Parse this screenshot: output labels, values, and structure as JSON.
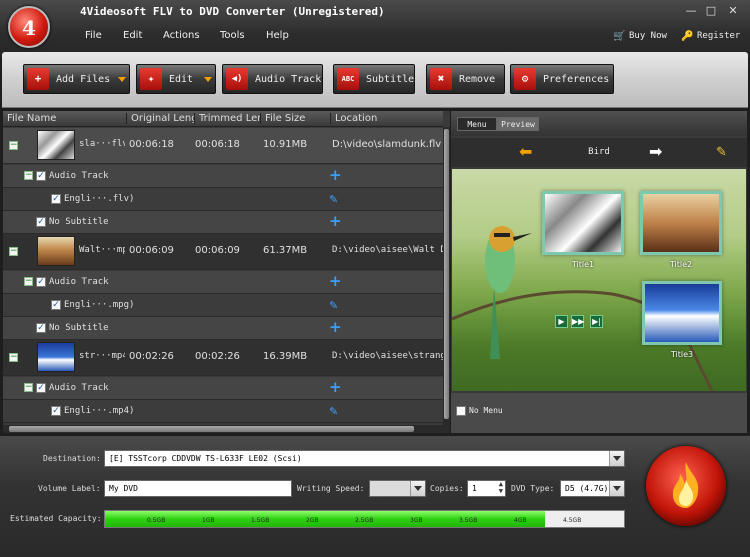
{
  "window": {
    "title": "4Videosoft FLV to DVD Converter (Unregistered)"
  },
  "menu": [
    "File",
    "Edit",
    "Actions",
    "Tools",
    "Help"
  ],
  "header_links": {
    "buy_now": "Buy Now",
    "register": "Register"
  },
  "toolbar": {
    "add_files": "Add Files",
    "add_files_icon": "+",
    "edit": "Edit",
    "edit_icon": "✦",
    "audio_track": "Audio Track",
    "audio_icon": "◀)",
    "subtitle": "Subtitle",
    "subtitle_icon": "ABC",
    "remove": "Remove",
    "remove_icon": "✖",
    "preferences": "Preferences",
    "preferences_icon": "⚙"
  },
  "file_list": {
    "columns": [
      "File Name",
      "Original Leng",
      "Trimmed Len",
      "File Size",
      "Location"
    ],
    "files": [
      {
        "name": "sla···flv",
        "original": "00:06:18",
        "trimmed": "00:06:18",
        "size": "10.91MB",
        "location": "D:\\video\\slamdunk.flv",
        "audio_label": "Audio Track",
        "audio_track": "Engli···.flv)",
        "subtitle": "No Subtitle"
      },
      {
        "name": "Walt···mpg",
        "original": "00:06:09",
        "trimmed": "00:06:09",
        "size": "61.37MB",
        "location": "D:\\video\\aisee\\Walt Dis",
        "audio_label": "Audio Track",
        "audio_track": "Engli···.mpg)",
        "subtitle": "No Subtitle"
      },
      {
        "name": "str···mp4",
        "original": "00:02:26",
        "trimmed": "00:02:26",
        "size": "16.39MB",
        "location": "D:\\video\\aisee\\strange",
        "audio_label": "Audio Track",
        "audio_track": "Engli···.mp4)"
      }
    ]
  },
  "preview": {
    "tabs": [
      "Menu",
      "Preview"
    ],
    "active_tab": "Preview",
    "menu_name": "Bird",
    "titles": [
      "Title1",
      "Title2",
      "Title3"
    ],
    "no_menu": "No Menu"
  },
  "output": {
    "destination_label": "Destination:",
    "destination": "[E] TSSTcorp CDDVDW TS-L633F LE02 (Scsi)",
    "volume_label_label": "Volume Label:",
    "volume_label": "My DVD",
    "writing_speed_label": "Writing Speed:",
    "copies_label": "Copies:",
    "copies": "1",
    "dvd_type_label": "DVD Type:",
    "dvd_type": "D5 (4.7G)",
    "capacity_label": "Estimated Capacity:",
    "capacity_ticks": [
      "0.5GB",
      "1GB",
      "1.5GB",
      "2GB",
      "2.5GB",
      "3GB",
      "3.5GB",
      "4GB",
      "4.5GB"
    ],
    "capacity_fill_fraction": 0.847
  },
  "colors": {
    "accent": "#d01a10",
    "capacity_fill": "#2ed012",
    "link_blue": "#3aa0ff"
  }
}
